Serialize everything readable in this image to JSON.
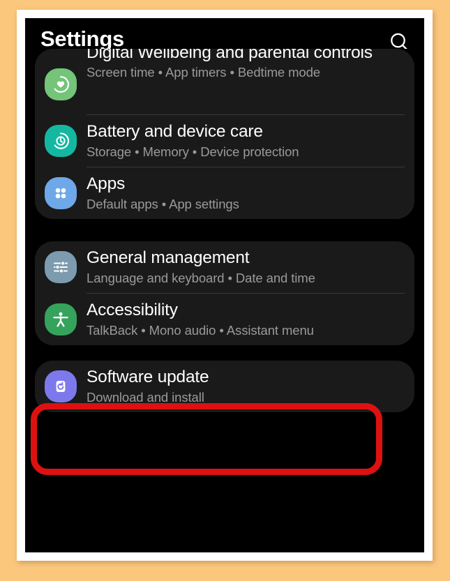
{
  "annotation": {
    "highlight_color": "#dd1111",
    "target": "Accessibility",
    "frame_background_color": "#fbc77d",
    "frame_border_color": "#ffffff"
  },
  "header": {
    "title": "Settings",
    "search_icon": "search-icon"
  },
  "sections": [
    {
      "name": "section-one",
      "items": [
        {
          "title": "Digital Wellbeing and parental controls",
          "subtitle": "Screen time • App timers • Bedtime mode",
          "icon": "digital-wellbeing-icon",
          "icon_color": "#74c47a",
          "clipped_top": true
        },
        {
          "title": "Battery and device care",
          "subtitle": "Storage • Memory • Device protection",
          "icon": "battery-device-care-icon",
          "icon_color": "#14b8a1"
        },
        {
          "title": "Apps",
          "subtitle": "Default apps • App settings",
          "icon": "apps-icon",
          "icon_color": "#6fa8e8"
        }
      ]
    },
    {
      "name": "section-two",
      "items": [
        {
          "title": "General management",
          "subtitle": "Language and keyboard • Date and time",
          "icon": "general-management-icon",
          "icon_color": "#7d9bae"
        },
        {
          "title": "Accessibility",
          "subtitle": "TalkBack • Mono audio • Assistant menu",
          "icon": "accessibility-icon",
          "icon_color": "#35a35c",
          "highlighted": true
        }
      ]
    },
    {
      "name": "section-three",
      "items": [
        {
          "title": "Software update",
          "subtitle": "Download and install",
          "icon": "software-update-icon",
          "icon_color": "#7d79ec"
        }
      ]
    }
  ]
}
